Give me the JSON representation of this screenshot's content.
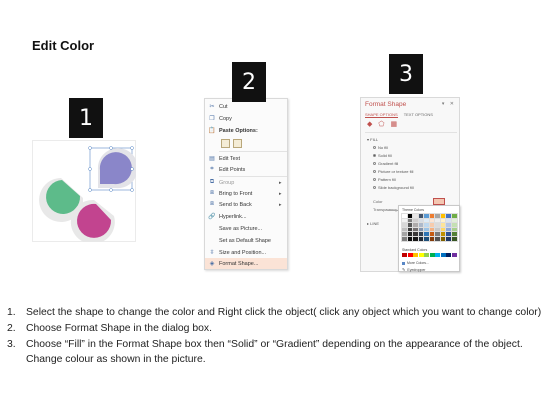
{
  "title": "Edit Color",
  "badges": [
    "1",
    "2",
    "3"
  ],
  "shapes": {
    "colors": {
      "green": "#5dbb8a",
      "purple": "#8a86c9",
      "magenta": "#c2448f",
      "outline_light": "#e3e3e3",
      "selection": "#5a88c6"
    }
  },
  "context_menu": {
    "items": [
      {
        "label": "Cut",
        "icon": "scissors-icon"
      },
      {
        "label": "Copy",
        "icon": "copy-icon"
      },
      {
        "label": "Paste Options:",
        "icon": "paste-icon"
      },
      {
        "label": "Edit Text",
        "icon": "edit-text-icon"
      },
      {
        "label": "Edit Points",
        "icon": "edit-points-icon"
      },
      {
        "label": "Group",
        "icon": "group-icon"
      },
      {
        "label": "Bring to Front",
        "icon": "bring-front-icon"
      },
      {
        "label": "Send to Back",
        "icon": "send-back-icon"
      },
      {
        "label": "Hyperlink...",
        "icon": "hyperlink-icon"
      },
      {
        "label": "Save as Picture...",
        "icon": ""
      },
      {
        "label": "Set as Default Shape",
        "icon": ""
      },
      {
        "label": "Size and Position...",
        "icon": "size-icon"
      },
      {
        "label": "Format Shape...",
        "icon": "format-shape-icon"
      }
    ]
  },
  "format_pane": {
    "title": "Format Shape",
    "tab_shape": "SHAPE OPTIONS",
    "tab_text": "TEXT OPTIONS",
    "fill_section": "FILL",
    "options": [
      "No fill",
      "Solid fill",
      "Gradient fill",
      "Picture or texture fill",
      "Pattern fill",
      "Slide background fill"
    ],
    "selected_option": "Solid fill",
    "color_label": "Color",
    "transparency_label": "Transparency",
    "line_section": "LINE",
    "accent": "#c0504d"
  },
  "palette": {
    "theme_label": "Theme Colors",
    "standard_label": "Standard Colors",
    "more_label": "More Colors...",
    "eyedropper_label": "Eyedropper",
    "theme_colors": [
      "#ffffff",
      "#000000",
      "#e7e6e6",
      "#44546a",
      "#5b9bd5",
      "#ed7d31",
      "#a5a5a5",
      "#ffc000",
      "#4472c4",
      "#70ad47",
      "#f2f2f2",
      "#7f7f7f",
      "#d0cece",
      "#d6dce4",
      "#deebf6",
      "#fbe5d5",
      "#ededed",
      "#fff2cc",
      "#dae3f3",
      "#e2efd9",
      "#d8d8d8",
      "#595959",
      "#aeabab",
      "#adb9ca",
      "#bdd7ee",
      "#f7cbac",
      "#dbdbdb",
      "#fee599",
      "#b4c6e7",
      "#c5e0b3",
      "#bfbfbf",
      "#3f3f3f",
      "#757070",
      "#8496b0",
      "#9cc3e5",
      "#f4b183",
      "#c9c9c9",
      "#ffd965",
      "#8eaadb",
      "#a8d08d",
      "#a5a5a5",
      "#262626",
      "#3a3838",
      "#323f4f",
      "#2e75b5",
      "#c55a11",
      "#7b7b7b",
      "#bf9000",
      "#2f5496",
      "#538135",
      "#7f7f7f",
      "#0c0c0c",
      "#171616",
      "#222a35",
      "#1e4e79",
      "#843c0b",
      "#525252",
      "#7f6000",
      "#1f3864",
      "#375623"
    ],
    "standard_colors": [
      "#c00000",
      "#ff0000",
      "#ffc000",
      "#ffff00",
      "#92d050",
      "#00b050",
      "#00b0f0",
      "#0070c0",
      "#002060",
      "#7030a0"
    ]
  },
  "steps": [
    {
      "num": "1.",
      "text": "Select the shape to change the color and Right click the object( click any object which you want to change color)"
    },
    {
      "num": "2.",
      "text": "Choose Format Shape in the dialog box."
    },
    {
      "num": "3.",
      "text": "Choose “Fill” in the Format Shape box then “Solid” or “Gradient” depending on the appearance of the object. Change colour as shown in the picture."
    }
  ]
}
